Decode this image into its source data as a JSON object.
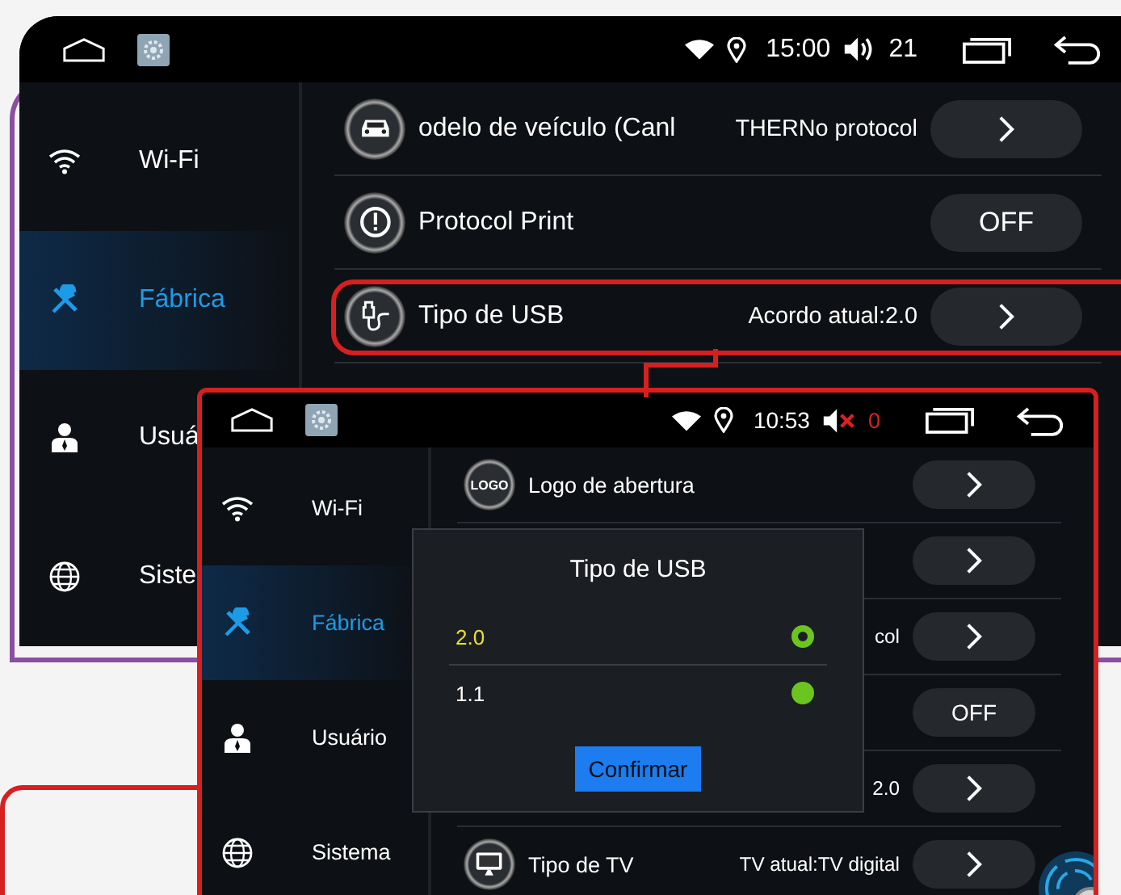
{
  "screens": [
    {
      "status_bar": {
        "time": "15:00",
        "volume": "21",
        "muted": false
      },
      "sidebar": [
        {
          "label": "Wi-Fi",
          "kind": "wifi",
          "selected": false
        },
        {
          "label": "Fábrica",
          "kind": "tools",
          "selected": true
        },
        {
          "label": "Usuá",
          "kind": "user",
          "selected": false
        },
        {
          "label": "Siste",
          "kind": "globe",
          "selected": false
        }
      ],
      "rows": [
        {
          "kind": "car",
          "label": "odelo de veículo (Canl",
          "value": "THERNo protocol",
          "control": {
            "kind": "chevron"
          },
          "highlighted": false
        },
        {
          "kind": "alert",
          "label": "Protocol Print",
          "control": {
            "kind": "toggle",
            "text": "OFF"
          },
          "highlighted": false
        },
        {
          "kind": "usb",
          "label": "Tipo de USB",
          "value": "Acordo atual:2.0",
          "control": {
            "kind": "chevron"
          },
          "highlighted": true
        }
      ]
    },
    {
      "status_bar": {
        "time": "10:53",
        "volume": "0",
        "muted": true
      },
      "sidebar": [
        {
          "label": "Wi-Fi",
          "kind": "wifi",
          "selected": false
        },
        {
          "label": "Fábrica",
          "kind": "tools",
          "selected": true
        },
        {
          "label": "Usuário",
          "kind": "user",
          "selected": false
        },
        {
          "label": "Sistema",
          "kind": "globe",
          "selected": false
        }
      ],
      "rows": [
        {
          "kind": "logo",
          "icon_text": "LOGO",
          "label": "Logo de abertura",
          "control": {
            "kind": "chevron"
          },
          "highlighted": false
        },
        {
          "kind": "hidden",
          "control": {
            "kind": "chevron"
          },
          "highlighted": false
        },
        {
          "kind": "hidden",
          "value": "col",
          "control": {
            "kind": "chevron"
          },
          "highlighted": false
        },
        {
          "kind": "hidden",
          "control": {
            "kind": "toggle",
            "text": "OFF"
          },
          "highlighted": false
        },
        {
          "kind": "hidden",
          "value": "2.0",
          "control": {
            "kind": "chevron"
          },
          "highlighted": false
        },
        {
          "kind": "tv",
          "label": "Tipo de TV",
          "value": "TV atual:TV digital",
          "control": {
            "kind": "chevron"
          },
          "highlighted": false
        }
      ],
      "dialog": {
        "title": "Tipo de USB",
        "options": [
          {
            "label": "2.0",
            "selected": true
          },
          {
            "label": "1.1",
            "selected": false
          }
        ],
        "button": "Confirmar"
      }
    }
  ]
}
